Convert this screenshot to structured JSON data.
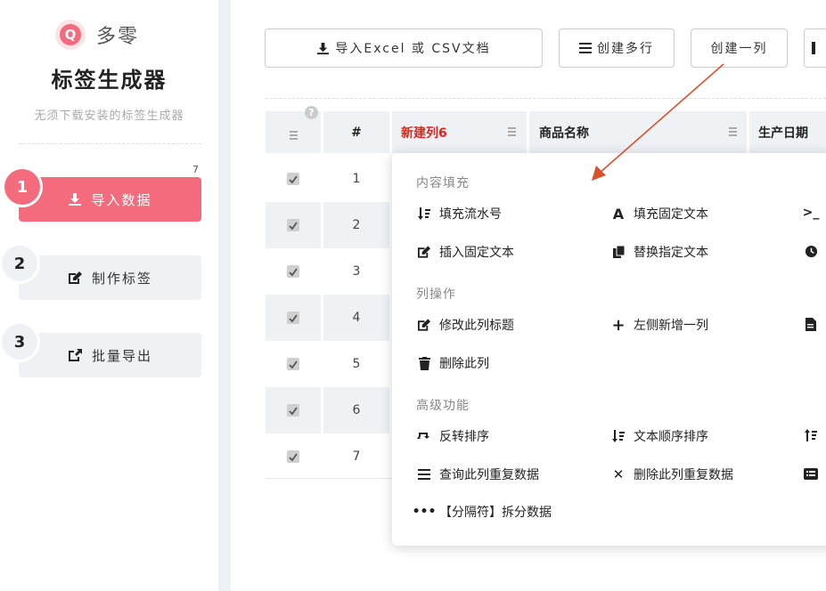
{
  "sidebar": {
    "logo_letter": "Q",
    "logo_name": "多零",
    "app_title": "标签生成器",
    "app_subtitle": "无须下载安装的标签生成器",
    "steps": [
      {
        "num": "1",
        "label": "导入数据",
        "icon": "download-icon",
        "active": true
      },
      {
        "num": "2",
        "label": "制作标签",
        "icon": "edit-icon",
        "active": false
      },
      {
        "num": "3",
        "label": "批量导出",
        "icon": "export-icon",
        "active": false
      }
    ],
    "step1_badge": "7"
  },
  "toolbar": {
    "import_label": "导入Excel 或 CSV文档",
    "create_rows_label": "创建多行",
    "create_column_label": "创建一列"
  },
  "table": {
    "help_icon": "?",
    "headers": [
      "#",
      "新建列6",
      "商品名称",
      "生产日期"
    ],
    "new_column_color": "#e0251c",
    "rows": [
      "1",
      "2",
      "3",
      "4",
      "5",
      "6",
      "7"
    ]
  },
  "menu": {
    "sections": [
      "内容填充",
      "列操作",
      "高级功能"
    ],
    "items": {
      "fill_serial": "填充流水号",
      "fill_fixed_text": "填充固定文本",
      "insert_fixed_text": "插入固定文本",
      "replace_text": "替换指定文本",
      "rename_column": "修改此列标题",
      "add_left_column": "左侧新增一列",
      "delete_column": "删除此列",
      "reverse_sort": "反转排序",
      "text_order_sort": "文本顺序排序",
      "query_duplicates": "查询此列重复数据",
      "delete_duplicates": "删除此列重复数据",
      "split_data": "【分隔符】拆分数据"
    }
  },
  "colors": {
    "accent": "#f36b7d",
    "highlight_border": "#d9522b",
    "arrow": "#d9522b"
  }
}
